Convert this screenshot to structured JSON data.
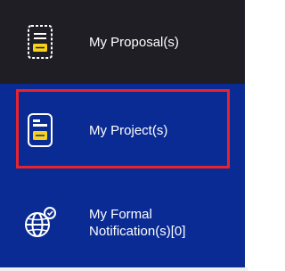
{
  "menu": {
    "items": [
      {
        "label": "My Proposal(s)",
        "icon": "proposal-document-icon",
        "selected": false
      },
      {
        "label": "My Project(s)",
        "icon": "project-document-icon",
        "selected": true
      },
      {
        "label_line1": "My Formal",
        "label_line2": "Notification(s)[0]",
        "icon": "globe-notification-icon",
        "selected": false
      }
    ]
  },
  "colors": {
    "dark_background": "#1e1e24",
    "nav_blue": "#0a2b93",
    "icon_yellow": "#f7d21c",
    "selection_outline": "#e8232d"
  }
}
